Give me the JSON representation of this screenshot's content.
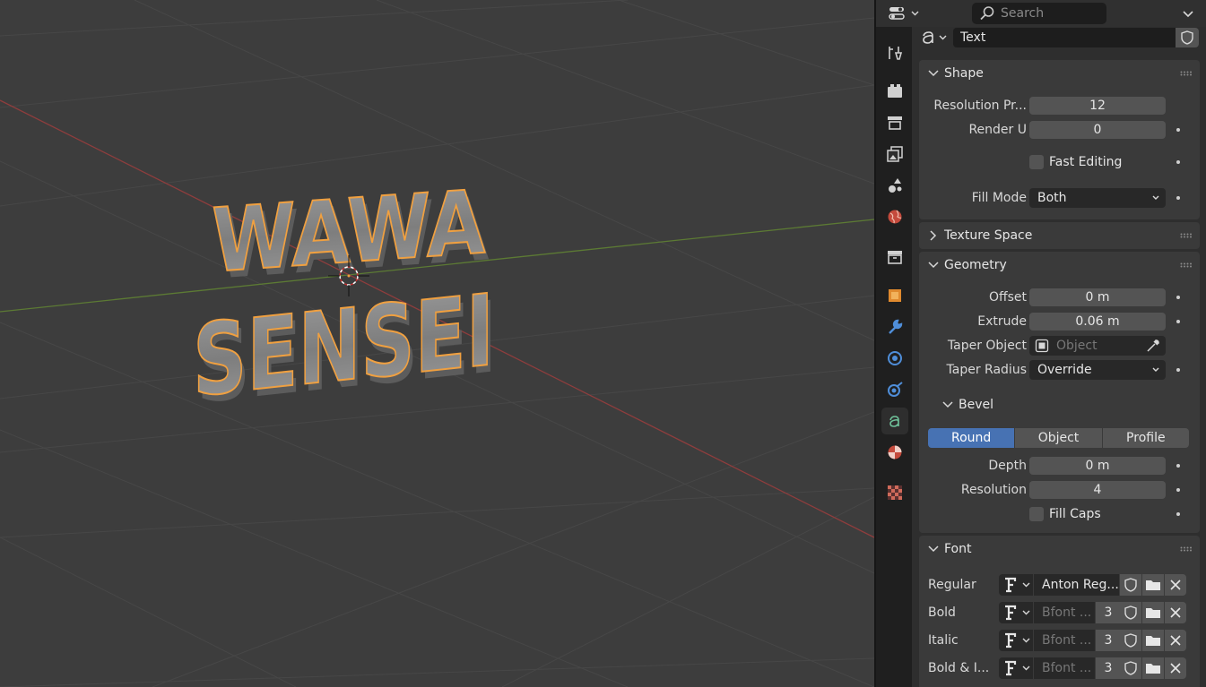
{
  "viewport": {
    "object_text_line1": "WAWA",
    "object_text_line2": "SENSEI",
    "colors": {
      "background": "#3d3d3d",
      "grid": "#464646",
      "x_axis": "#8a3a3a",
      "y_axis": "#5a7a30",
      "selection_outline": "#f0a040"
    }
  },
  "header": {
    "editor_type_icon": "properties-editor-icon",
    "search_placeholder": "Search"
  },
  "tabs": [
    {
      "name": "tool",
      "icon": "tool-icon"
    },
    {
      "name": "render",
      "icon": "render-icon"
    },
    {
      "name": "output",
      "icon": "output-icon"
    },
    {
      "name": "view-layer",
      "icon": "view-layer-icon"
    },
    {
      "name": "scene",
      "icon": "scene-icon"
    },
    {
      "name": "world",
      "icon": "world-icon"
    },
    {
      "name": "collection",
      "icon": "collection-icon"
    },
    {
      "name": "object",
      "icon": "object-icon"
    },
    {
      "name": "modifiers",
      "icon": "wrench-icon"
    },
    {
      "name": "particles",
      "icon": "particles-icon"
    },
    {
      "name": "physics",
      "icon": "physics-icon"
    },
    {
      "name": "data",
      "icon": "text-data-icon",
      "active": true
    },
    {
      "name": "material",
      "icon": "material-icon"
    },
    {
      "name": "texture",
      "icon": "texture-icon"
    }
  ],
  "datablock": {
    "name": "Text"
  },
  "shape": {
    "title": "Shape",
    "resolution_preview_label": "Resolution Pr...",
    "resolution_preview_value": "12",
    "render_u_label": "Render U",
    "render_u_value": "0",
    "fast_editing_label": "Fast Editing",
    "fill_mode_label": "Fill Mode",
    "fill_mode_value": "Both"
  },
  "texture_space": {
    "title": "Texture Space"
  },
  "geometry": {
    "title": "Geometry",
    "offset_label": "Offset",
    "offset_value": "0 m",
    "extrude_label": "Extrude",
    "extrude_value": "0.06 m",
    "taper_object_label": "Taper Object",
    "taper_object_placeholder": "Object",
    "taper_radius_label": "Taper Radius",
    "taper_radius_value": "Override"
  },
  "bevel": {
    "title": "Bevel",
    "modes": [
      "Round",
      "Object",
      "Profile"
    ],
    "active_mode": "Round",
    "depth_label": "Depth",
    "depth_value": "0 m",
    "resolution_label": "Resolution",
    "resolution_value": "4",
    "fill_caps_label": "Fill Caps"
  },
  "font": {
    "title": "Font",
    "regular": {
      "label": "Regular",
      "name": "Anton Reg..."
    },
    "bold": {
      "label": "Bold",
      "name": "Bfont ...",
      "users": "3"
    },
    "italic": {
      "label": "Italic",
      "name": "Bfont ...",
      "users": "3"
    },
    "bold_italic": {
      "label": "Bold & I...",
      "name": "Bfont ...",
      "users": "3"
    }
  },
  "colors": {
    "accent": "#4772b3",
    "panel": "#3a3a3a",
    "field": "#545454",
    "dropdown": "#282828"
  }
}
